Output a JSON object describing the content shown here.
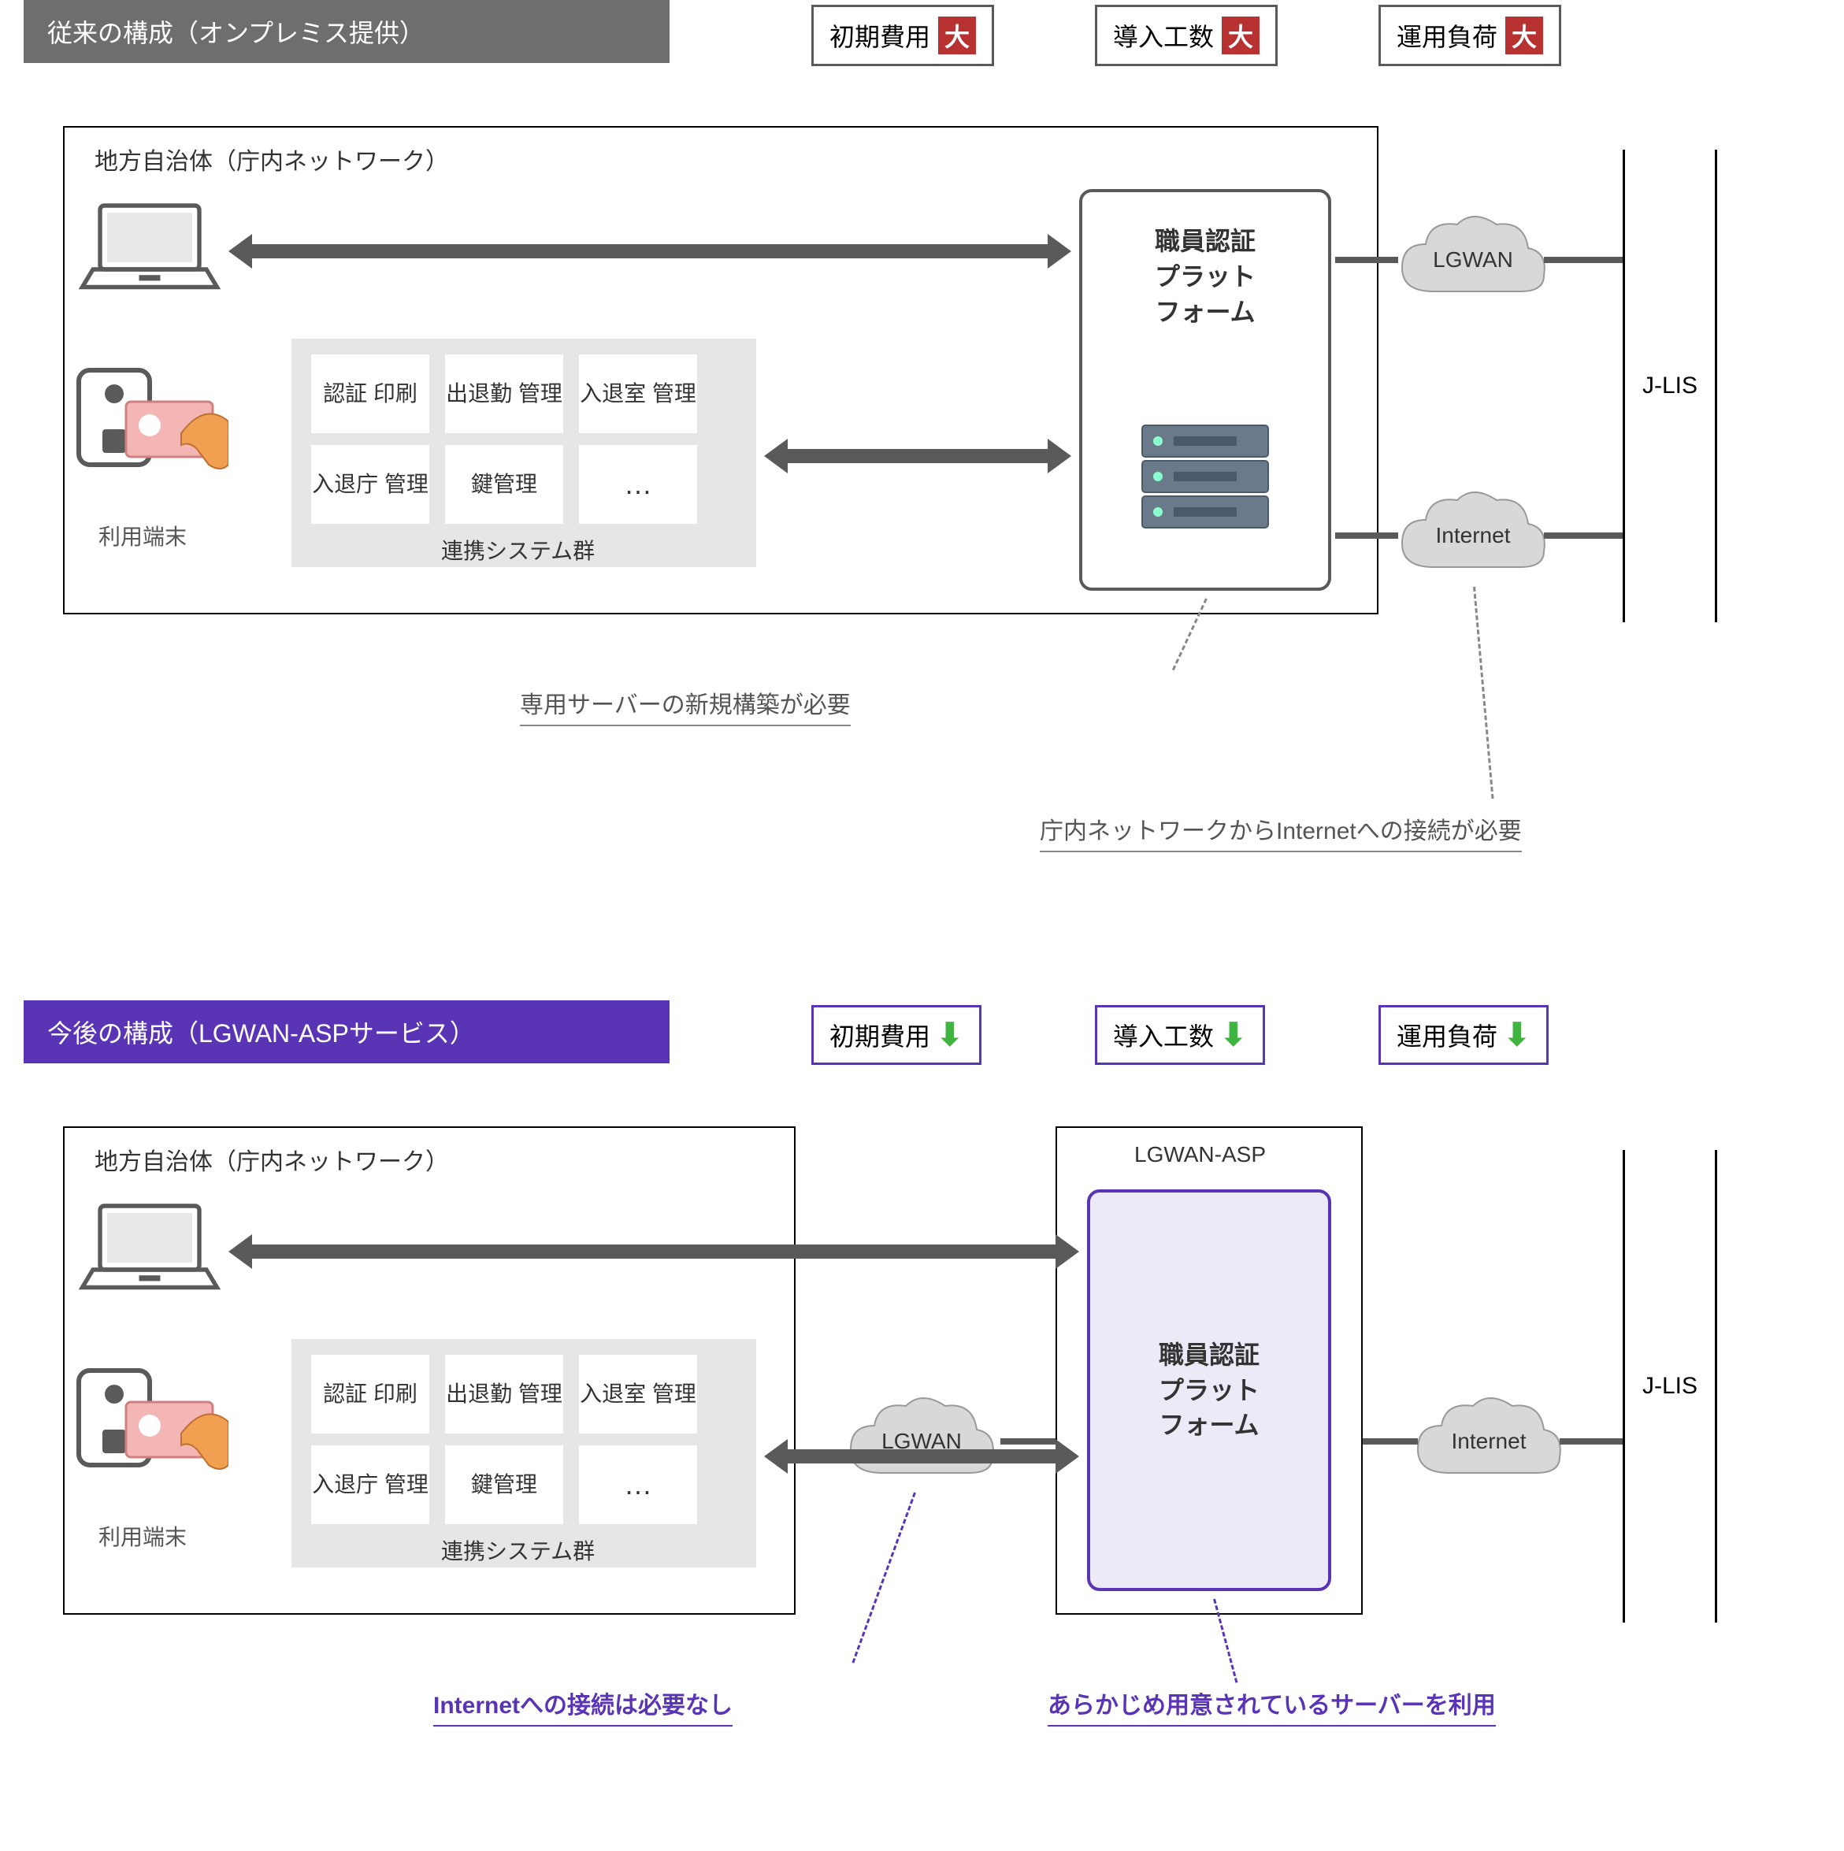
{
  "top": {
    "title": "従来の構成（オンプレミス提供）",
    "badges": {
      "b1": "初期費用",
      "b2": "導入工数",
      "b3": "運用負荷",
      "big": "大"
    },
    "outer_label": "地方自治体（庁内ネットワーク）",
    "mods": {
      "m1": "認証\n印刷",
      "m2": "出退勤\n管理",
      "m3": "入退室\n管理",
      "m4": "入退庁\n管理",
      "m5": "鍵管理",
      "m6": "…"
    },
    "mod_group_label": "連携システム群",
    "platform": "職員認証\nプラット\nフォーム",
    "terminal_label": "利用端末",
    "cloud1": "LGWAN",
    "cloud2": "Internet",
    "jlis": "J-LIS",
    "note1": "専用サーバーの新規構築が必要",
    "note2": "庁内ネットワークからInternetへの接続が必要"
  },
  "bottom": {
    "title": "今後の構成（LGWAN-ASPサービス）",
    "badges": {
      "b1": "初期費用",
      "b2": "導入工数",
      "b3": "運用負荷"
    },
    "outer_label": "地方自治体（庁内ネットワーク）",
    "mods": {
      "m1": "認証\n印刷",
      "m2": "出退勤\n管理",
      "m3": "入退室\n管理",
      "m4": "入退庁\n管理",
      "m5": "鍵管理",
      "m6": "…"
    },
    "mod_group_label": "連携システム群",
    "asp_label": "LGWAN-ASP",
    "platform": "職員認証\nプラット\nフォーム",
    "terminal_label": "利用端末",
    "cloud1": "LGWAN",
    "cloud2": "Internet",
    "jlis": "J-LIS",
    "note1": "Internetへの接続は必要なし",
    "note2": "あらかじめ用意されているサーバーを利用"
  }
}
